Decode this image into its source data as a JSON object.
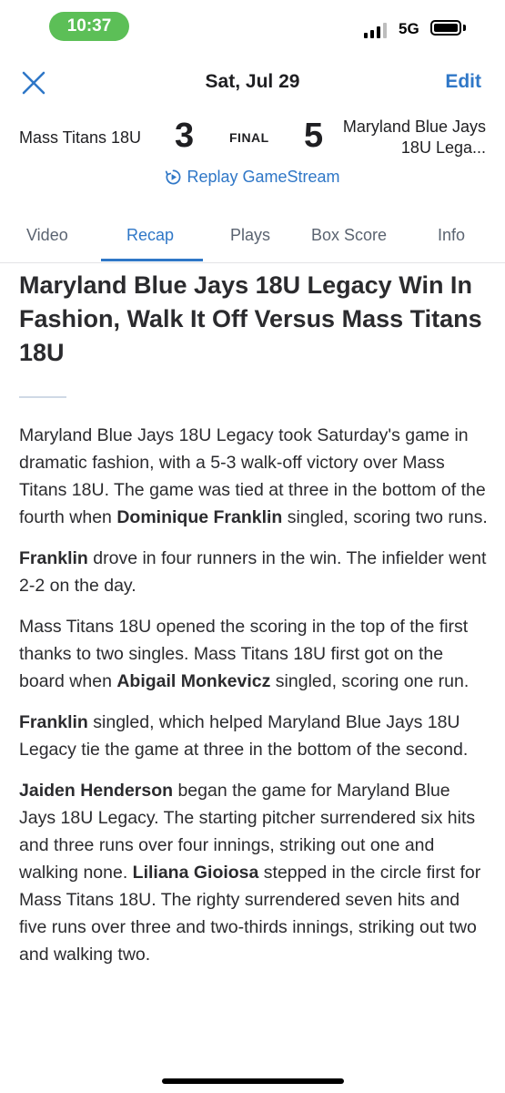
{
  "status": {
    "time": "10:37",
    "network": "5G"
  },
  "header": {
    "date": "Sat, Jul 29",
    "edit_label": "Edit"
  },
  "game": {
    "away_team": "Mass Titans 18U",
    "away_score": "3",
    "status": "FINAL",
    "home_score": "5",
    "home_team": "Maryland Blue Jays 18U Lega...",
    "replay_label": "Replay GameStream"
  },
  "tabs": [
    {
      "label": "Video"
    },
    {
      "label": "Recap"
    },
    {
      "label": "Plays"
    },
    {
      "label": "Box Score"
    },
    {
      "label": "Info"
    }
  ],
  "colors": {
    "accent": "#2f77c7",
    "time_pill": "#5cbf57",
    "text": "#2b2b2e"
  },
  "article": {
    "title": "Maryland Blue Jays 18U Legacy Win In Fashion, Walk It Off Versus Mass Titans 18U",
    "p1": {
      "t1": "Maryland Blue Jays 18U Legacy took Saturday's game in dramatic fashion, with a 5-3 walk-off victory over Mass Titans 18U. The game was tied at three in the bottom of the fourth when ",
      "b1": "Dominique Franklin",
      "t2": " singled, scoring two runs."
    },
    "p2": {
      "b1": "Franklin",
      "t1": " drove in four runners in the win. The infielder went 2-2 on the day."
    },
    "p3": {
      "t1": "Mass Titans 18U opened the scoring in the top of the first thanks to two singles. Mass Titans 18U first got on the board when ",
      "b1": "Abigail Monkevicz",
      "t2": " singled, scoring one run."
    },
    "p4": {
      "b1": "Franklin",
      "t1": " singled, which helped Maryland Blue Jays 18U Legacy tie the game at three in the bottom of the second."
    },
    "p5": {
      "b1": "Jaiden Henderson",
      "t1": " began the game for Maryland Blue Jays 18U Legacy. The starting pitcher surrendered six hits and three runs over four innings, striking out one and walking none. ",
      "b2": "Liliana Gioiosa",
      "t2": " stepped in the circle first for Mass Titans 18U. The righty surrendered seven hits and five runs over three and two-thirds innings, striking out two and walking two."
    }
  }
}
